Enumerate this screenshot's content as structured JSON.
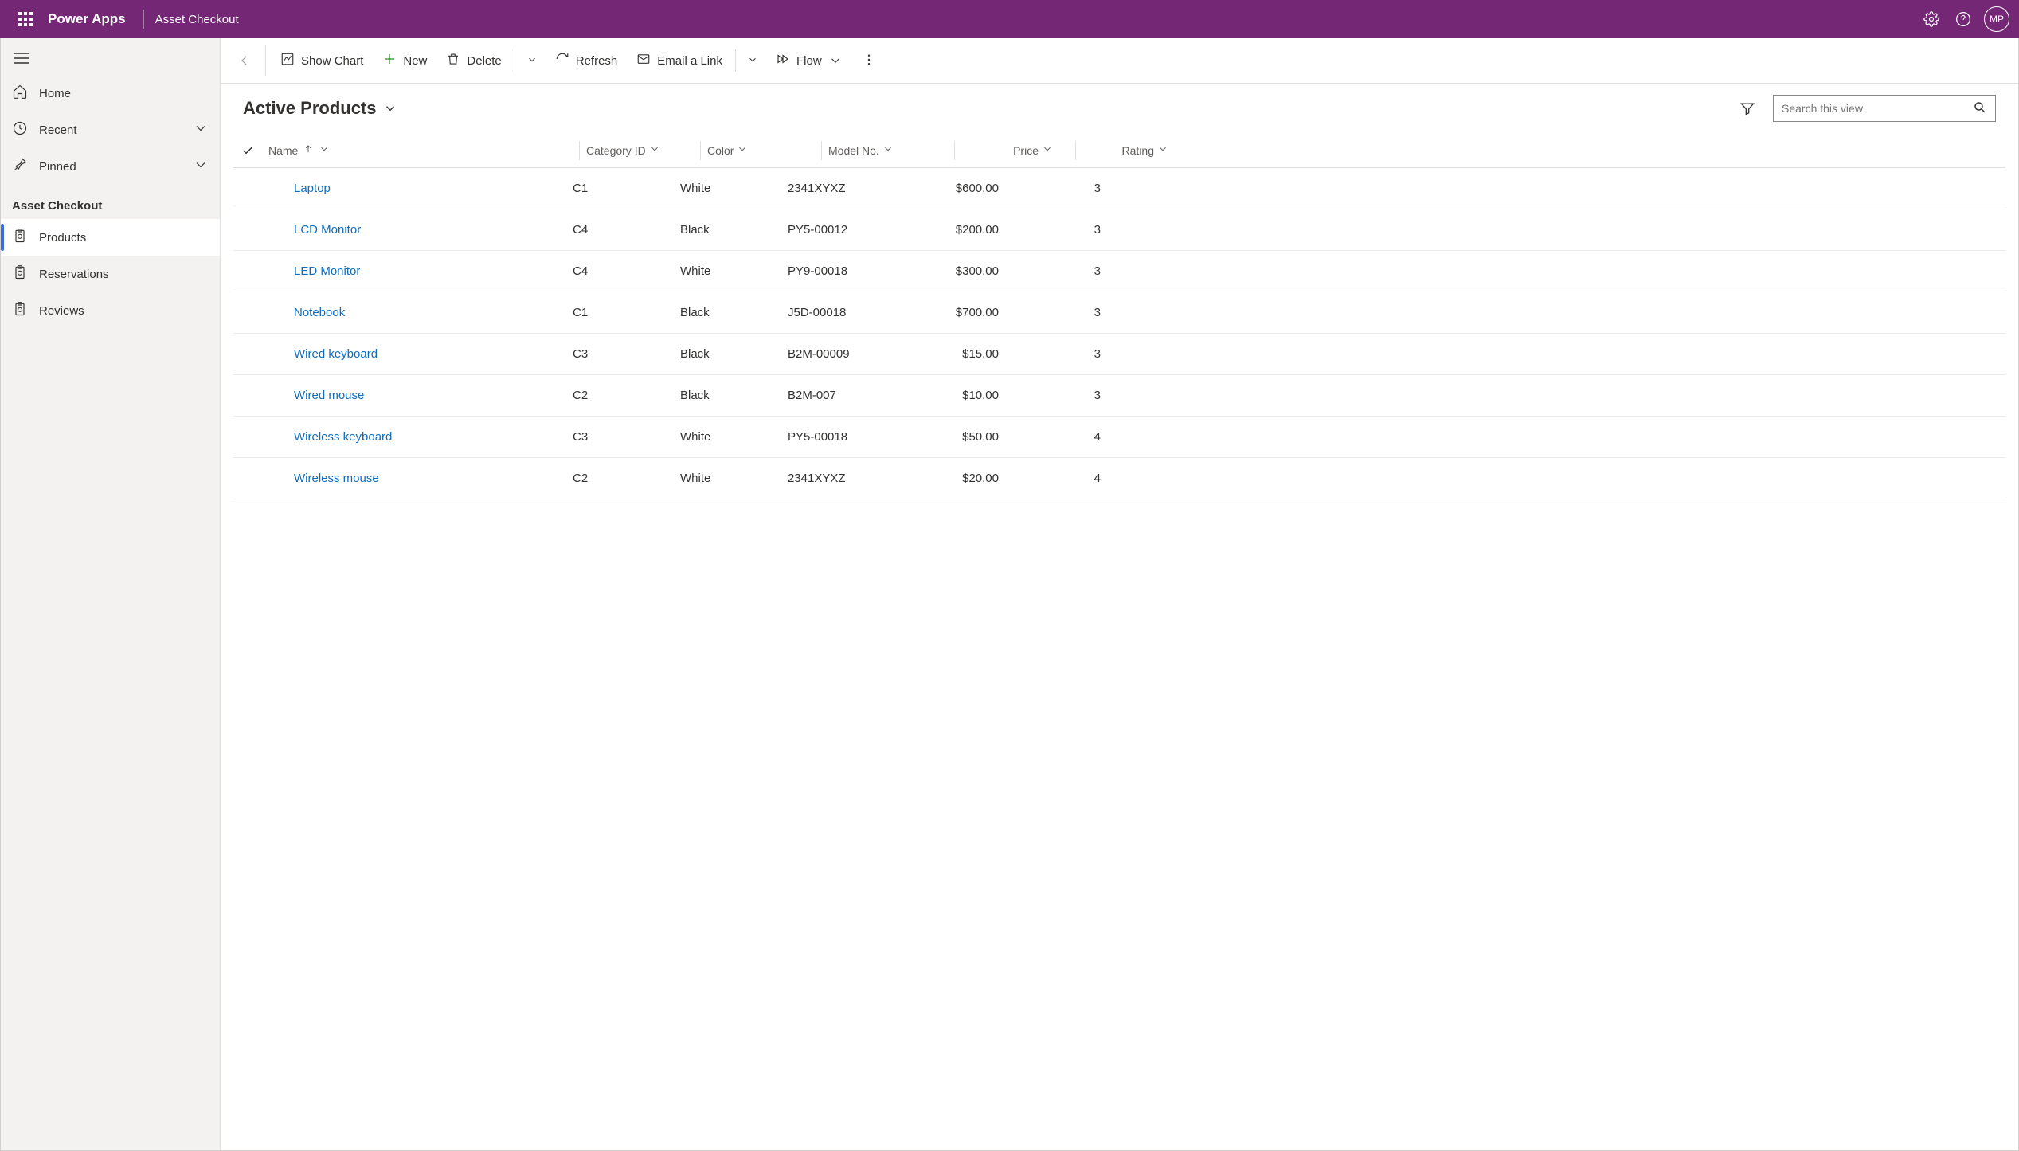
{
  "header": {
    "app_name": "Power Apps",
    "context": "Asset Checkout",
    "avatar_initials": "MP"
  },
  "sidebar": {
    "home": "Home",
    "recent": "Recent",
    "pinned": "Pinned",
    "section_title": "Asset Checkout",
    "items": [
      {
        "label": "Products"
      },
      {
        "label": "Reservations"
      },
      {
        "label": "Reviews"
      }
    ]
  },
  "commandbar": {
    "show_chart": "Show Chart",
    "new": "New",
    "delete": "Delete",
    "refresh": "Refresh",
    "email_link": "Email a Link",
    "flow": "Flow"
  },
  "view": {
    "title": "Active Products",
    "search_placeholder": "Search this view"
  },
  "grid": {
    "columns": {
      "name": "Name",
      "category": "Category ID",
      "color": "Color",
      "model": "Model No.",
      "price": "Price",
      "rating": "Rating"
    },
    "rows": [
      {
        "name": "Laptop",
        "category": "C1",
        "color": "White",
        "model": "2341XYXZ",
        "price": "$600.00",
        "rating": "3"
      },
      {
        "name": "LCD Monitor",
        "category": "C4",
        "color": "Black",
        "model": "PY5-00012",
        "price": "$200.00",
        "rating": "3"
      },
      {
        "name": "LED Monitor",
        "category": "C4",
        "color": "White",
        "model": "PY9-00018",
        "price": "$300.00",
        "rating": "3"
      },
      {
        "name": "Notebook",
        "category": "C1",
        "color": "Black",
        "model": "J5D-00018",
        "price": "$700.00",
        "rating": "3"
      },
      {
        "name": "Wired keyboard",
        "category": "C3",
        "color": "Black",
        "model": "B2M-00009",
        "price": "$15.00",
        "rating": "3"
      },
      {
        "name": "Wired mouse",
        "category": "C2",
        "color": "Black",
        "model": "B2M-007",
        "price": "$10.00",
        "rating": "3"
      },
      {
        "name": "Wireless keyboard",
        "category": "C3",
        "color": "White",
        "model": "PY5-00018",
        "price": "$50.00",
        "rating": "4"
      },
      {
        "name": "Wireless mouse",
        "category": "C2",
        "color": "White",
        "model": "2341XYXZ",
        "price": "$20.00",
        "rating": "4"
      }
    ]
  }
}
